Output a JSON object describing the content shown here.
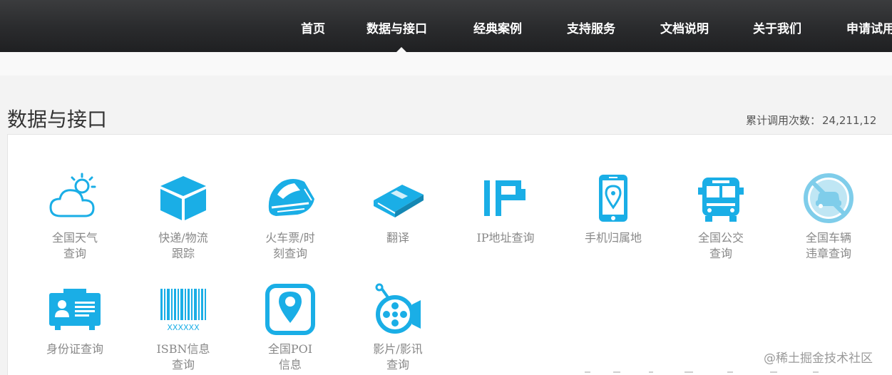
{
  "nav": {
    "items": [
      "首页",
      "数据与接口",
      "经典案例",
      "支持服务",
      "文档说明",
      "关于我们",
      "申请试用"
    ],
    "active_index": 1
  },
  "page": {
    "title": "数据与接口",
    "call_count_label": "累计调用次数：",
    "call_count_value": "24,211,12"
  },
  "tiles": [
    {
      "label": "全国天气\n查询",
      "icon": "weather-icon"
    },
    {
      "label": "快递/物流\n跟踪",
      "icon": "package-box-icon"
    },
    {
      "label": "火车票/时\n刻查询",
      "icon": "train-icon"
    },
    {
      "label": "翻译",
      "icon": "book-icon"
    },
    {
      "label": "IP地址查询",
      "icon": "ip-icon"
    },
    {
      "label": "手机归属地",
      "icon": "phone-location-icon"
    },
    {
      "label": "全国公交\n查询",
      "icon": "bus-icon"
    },
    {
      "label": "全国车辆\n违章查询",
      "icon": "no-car-icon"
    },
    {
      "label": "身份证查询",
      "icon": "id-card-icon"
    },
    {
      "label": "ISBN信息\n查询",
      "icon": "barcode-icon",
      "barcode_text": "XXXXXX"
    },
    {
      "label": "全国POI\n信息",
      "icon": "map-pin-icon"
    },
    {
      "label": "影片/影讯\n查询",
      "icon": "film-reel-icon"
    }
  ],
  "colors": {
    "icon_blue": "#1aaee6",
    "nav_text": "#ffffff",
    "label_gray": "#888888"
  },
  "watermark": "@稀土掘金技术社区"
}
